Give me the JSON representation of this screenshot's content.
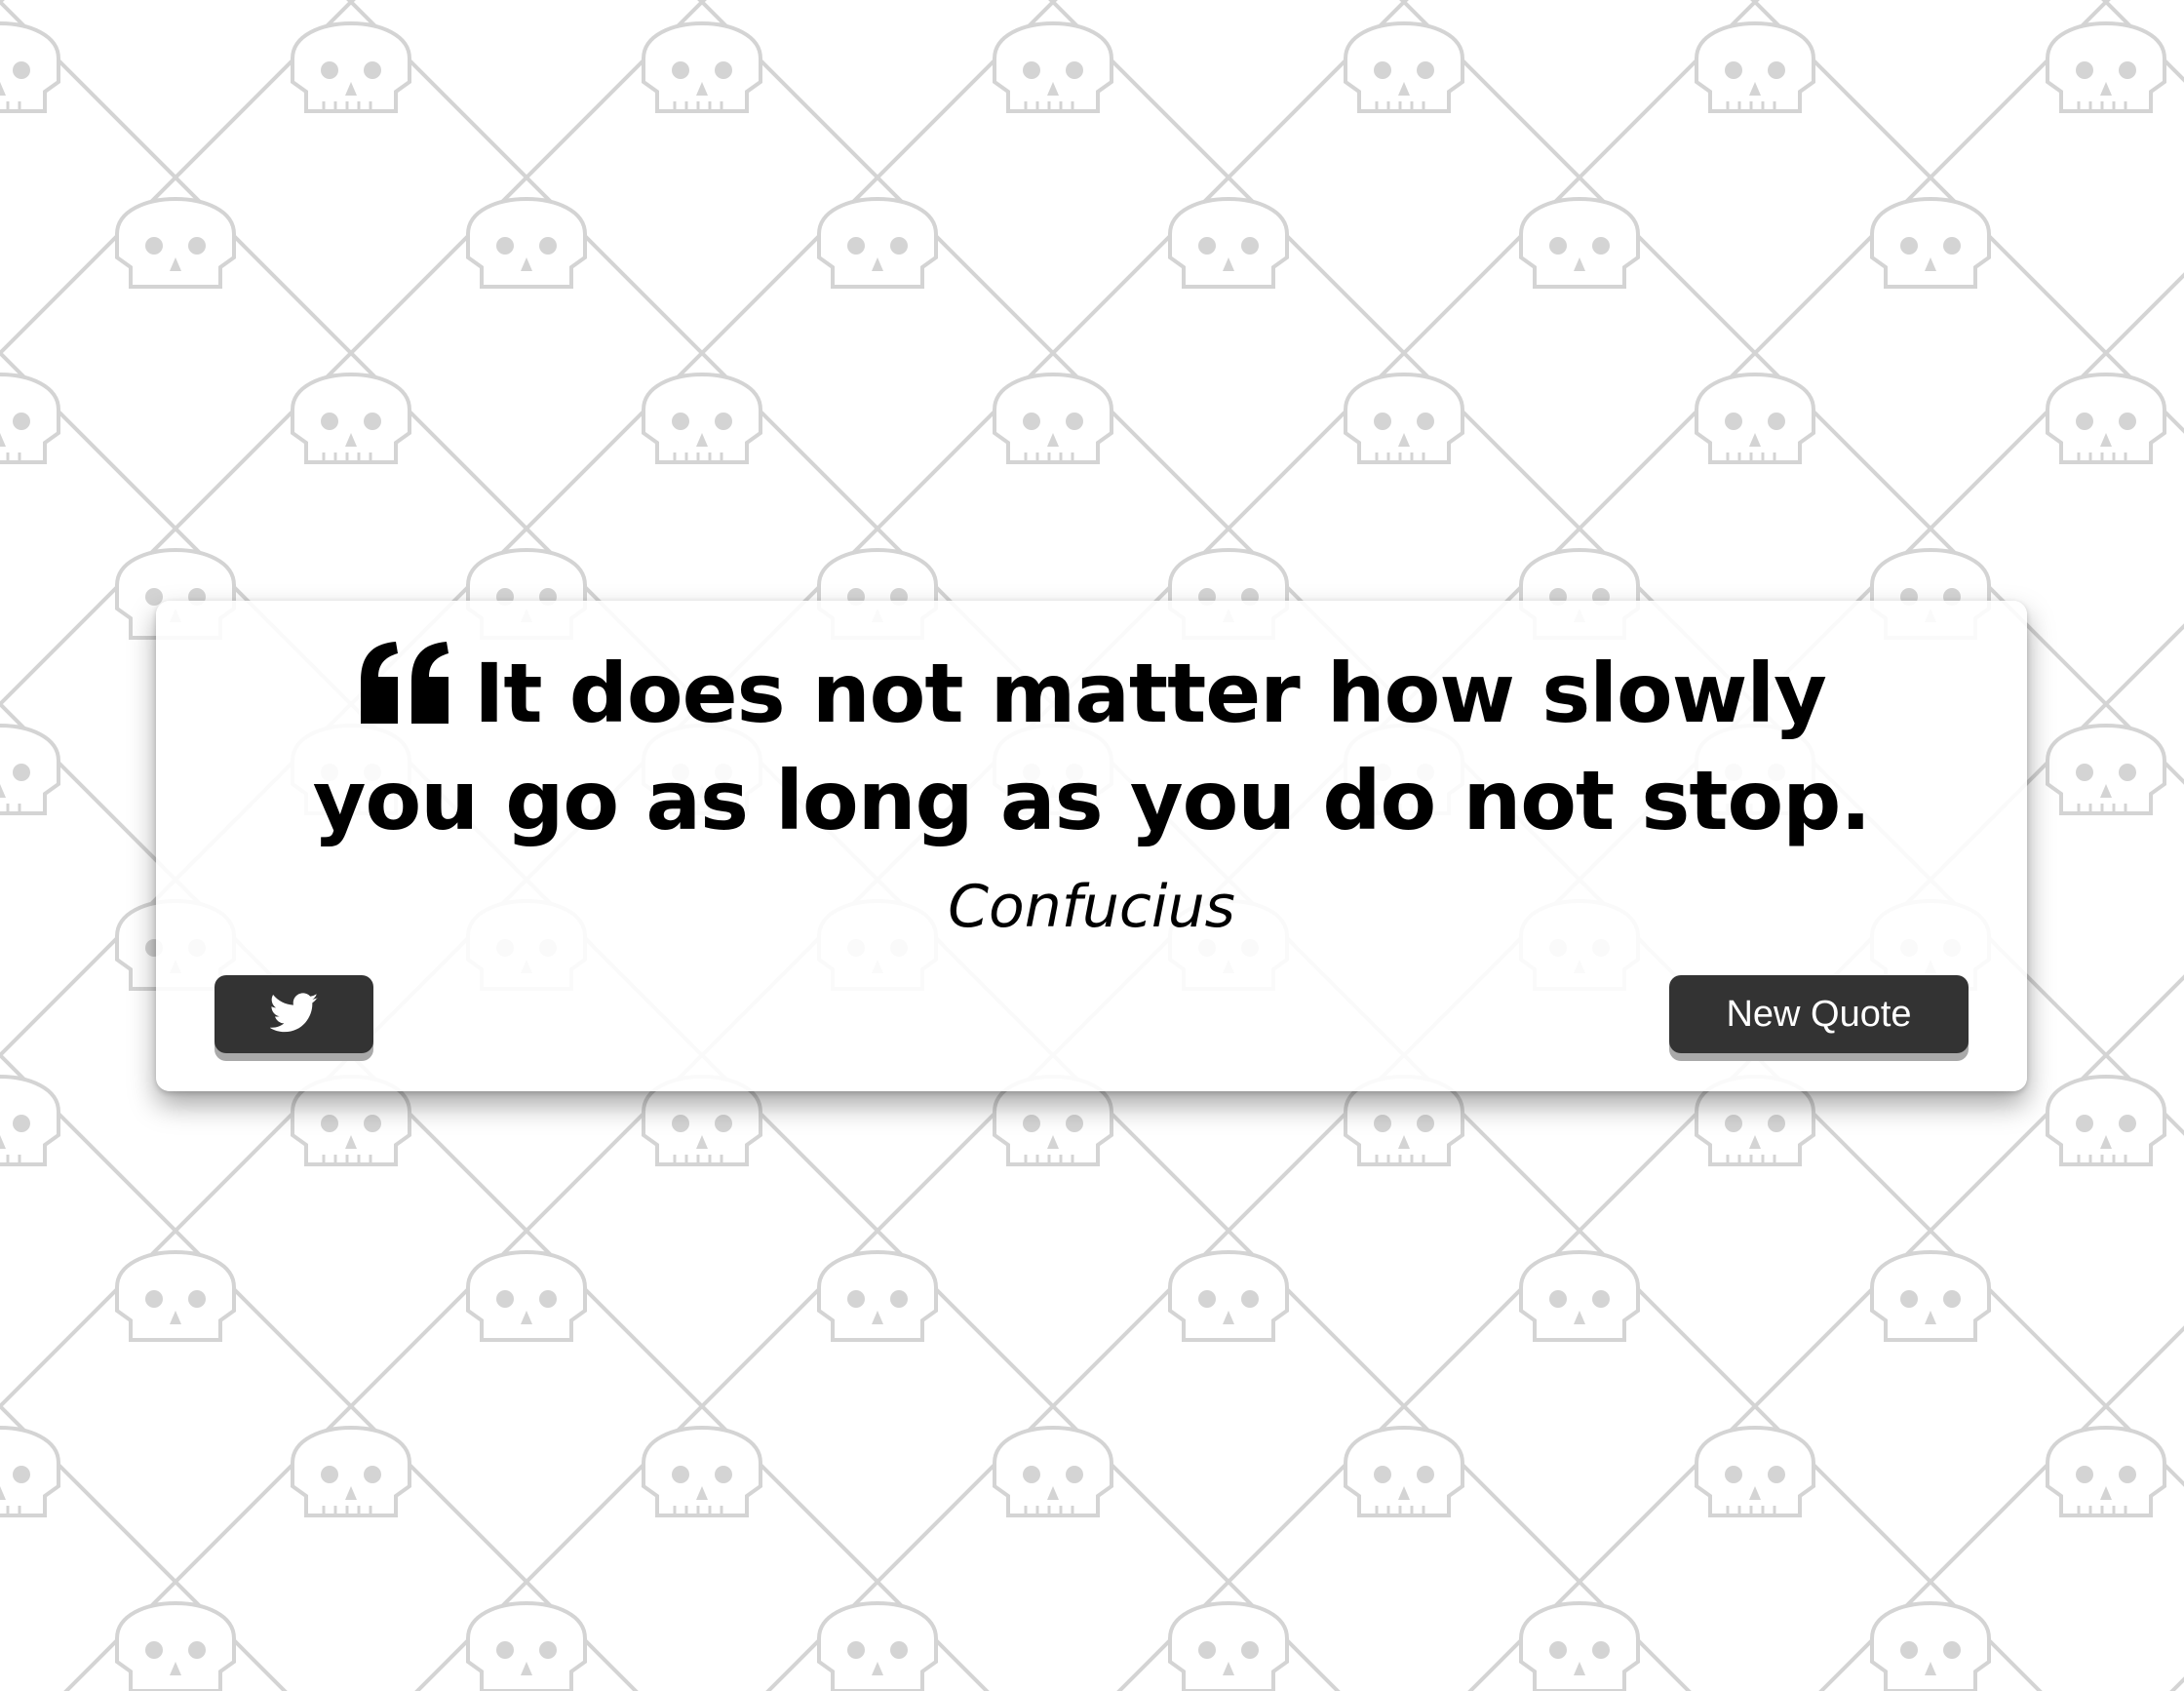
{
  "quote": {
    "text": "It does not matter how slowly you go as long as you do not stop.",
    "author": "Confucius"
  },
  "buttons": {
    "twitter_icon": "twitter-icon",
    "new_quote_label": "New Quote"
  },
  "background": {
    "pattern_icon": "skull-icon",
    "pattern_color": "#d4d4d4"
  },
  "colors": {
    "button_bg": "#333333",
    "button_shadow": "#a9a9a9",
    "text": "#000000"
  }
}
